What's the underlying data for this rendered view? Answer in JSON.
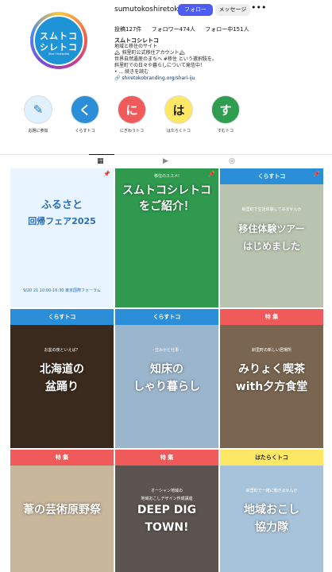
{
  "header": {
    "username": "sumutokoshiretoko",
    "follow_label": "フォロー",
    "message_label": "メッセージ",
    "more_label": "•••"
  },
  "avatar": {
    "line1": "スムトコ",
    "line2": "シレトコ",
    "line3": "Shari Hokkaido"
  },
  "stats": {
    "posts": "投稿127件",
    "followers": "フォロワー474人",
    "following": "フォロー中151人"
  },
  "bio": {
    "name": "スムトコシレトコ",
    "line1": "地域と移住のサイト",
    "line2": "🏔 斜里町公式移住アカウント🏔",
    "line3": "世界自然遺産のまちへ #移住 という選択肢を。",
    "line4": "斜里町での日々や暮らしについて発信中！",
    "line5": "• ... 続きを読む",
    "link": "🔗 shiretokobranding.org/shari-iju"
  },
  "highlights": [
    {
      "label": "お題に参加",
      "glyph": "✎",
      "bg": "#dff0ff",
      "fg": "#2a7cc7"
    },
    {
      "label": "くらすトコ",
      "glyph": "く",
      "bg": "#2a8fd8",
      "fg": "#ffffff"
    },
    {
      "label": "にぎわうトコ",
      "glyph": "に",
      "bg": "#f15a5a",
      "fg": "#ffffff"
    },
    {
      "label": "はたらくトコ",
      "glyph": "は",
      "bg": "#ffe766",
      "fg": "#222222"
    },
    {
      "label": "すむトコ",
      "glyph": "す",
      "bg": "#2e9d4f",
      "fg": "#ffffff"
    }
  ],
  "tabs": {
    "grid": "▦",
    "reels": "▶",
    "tagged": "◎"
  },
  "posts": [
    {
      "bar": "",
      "title1": "ふるさと",
      "title2": "回帰フェア2025",
      "small": "9/20 21 10:00-16:30 東京国際フォーラム",
      "small2": "",
      "bg": "#e8f4ff",
      "bar_bg": "",
      "title_color": "#2c6fb8",
      "pin": "📌"
    },
    {
      "bar": "",
      "title1": "スムトコシレトコ",
      "title2": "をご紹介！",
      "small": "移住のススメ!",
      "small2": "",
      "bg": "#2f9a4d",
      "bar_bg": "",
      "title_color": "#ffffff",
      "pin": "📌"
    },
    {
      "bar": "くらすトコ",
      "title1": "移住体験ツアー",
      "title2": "はじめました",
      "small": "斜里町で生活体験してみませんか",
      "small2": "",
      "bg": "#b8c4b0",
      "bar_bg": "#2a8fd8",
      "title_color": "#ffffff",
      "pin": "📌"
    },
    {
      "bar": "くらすトコ",
      "title1": "北海道の",
      "title2": "盆踊り",
      "small": "お盆の夜といえば？",
      "small2": "",
      "bg": "#3a2a1e",
      "bar_bg": "#2a8fd8",
      "title_color": "#ffffff",
      "pin": ""
    },
    {
      "bar": "くらすトコ",
      "title1": "知床の",
      "title2": "しゃり暮らし",
      "small": "- 住みかと仕事 -",
      "small2": "",
      "bg": "#9bb5cc",
      "bar_bg": "#2a8fd8",
      "title_color": "#ffffff",
      "pin": ""
    },
    {
      "bar": "特 集",
      "title1": "みりょく喫茶",
      "title2": "with夕方食堂",
      "small": "斜里町の新しい居場所",
      "small2": "",
      "bg": "#7a6650",
      "bar_bg": "#f15a5a",
      "title_color": "#ffffff",
      "pin": ""
    },
    {
      "bar": "特 集",
      "title1": "葦の芸術原野祭",
      "title2": "",
      "small": "",
      "small2": "",
      "bg": "#c9b79c",
      "bar_bg": "#f15a5a",
      "title_color": "#ffffff",
      "pin": ""
    },
    {
      "bar": "特 集",
      "title1": "DEEP DIG",
      "title2": "TOWN!",
      "small": "オーシャン地域の",
      "small2": "地域おこしデザイン作成講座",
      "bg": "#5c5450",
      "bar_bg": "#f15a5a",
      "title_color": "#ffffff",
      "pin": ""
    },
    {
      "bar": "はたらくトコ",
      "title1": "地域おこし",
      "title2": "協力隊",
      "small": "斜里町で一緒に働きませんか",
      "small2": "",
      "bg": "#a7c3da",
      "bar_bg": "#ffe766",
      "title_color": "#ffffff",
      "pin": ""
    }
  ]
}
